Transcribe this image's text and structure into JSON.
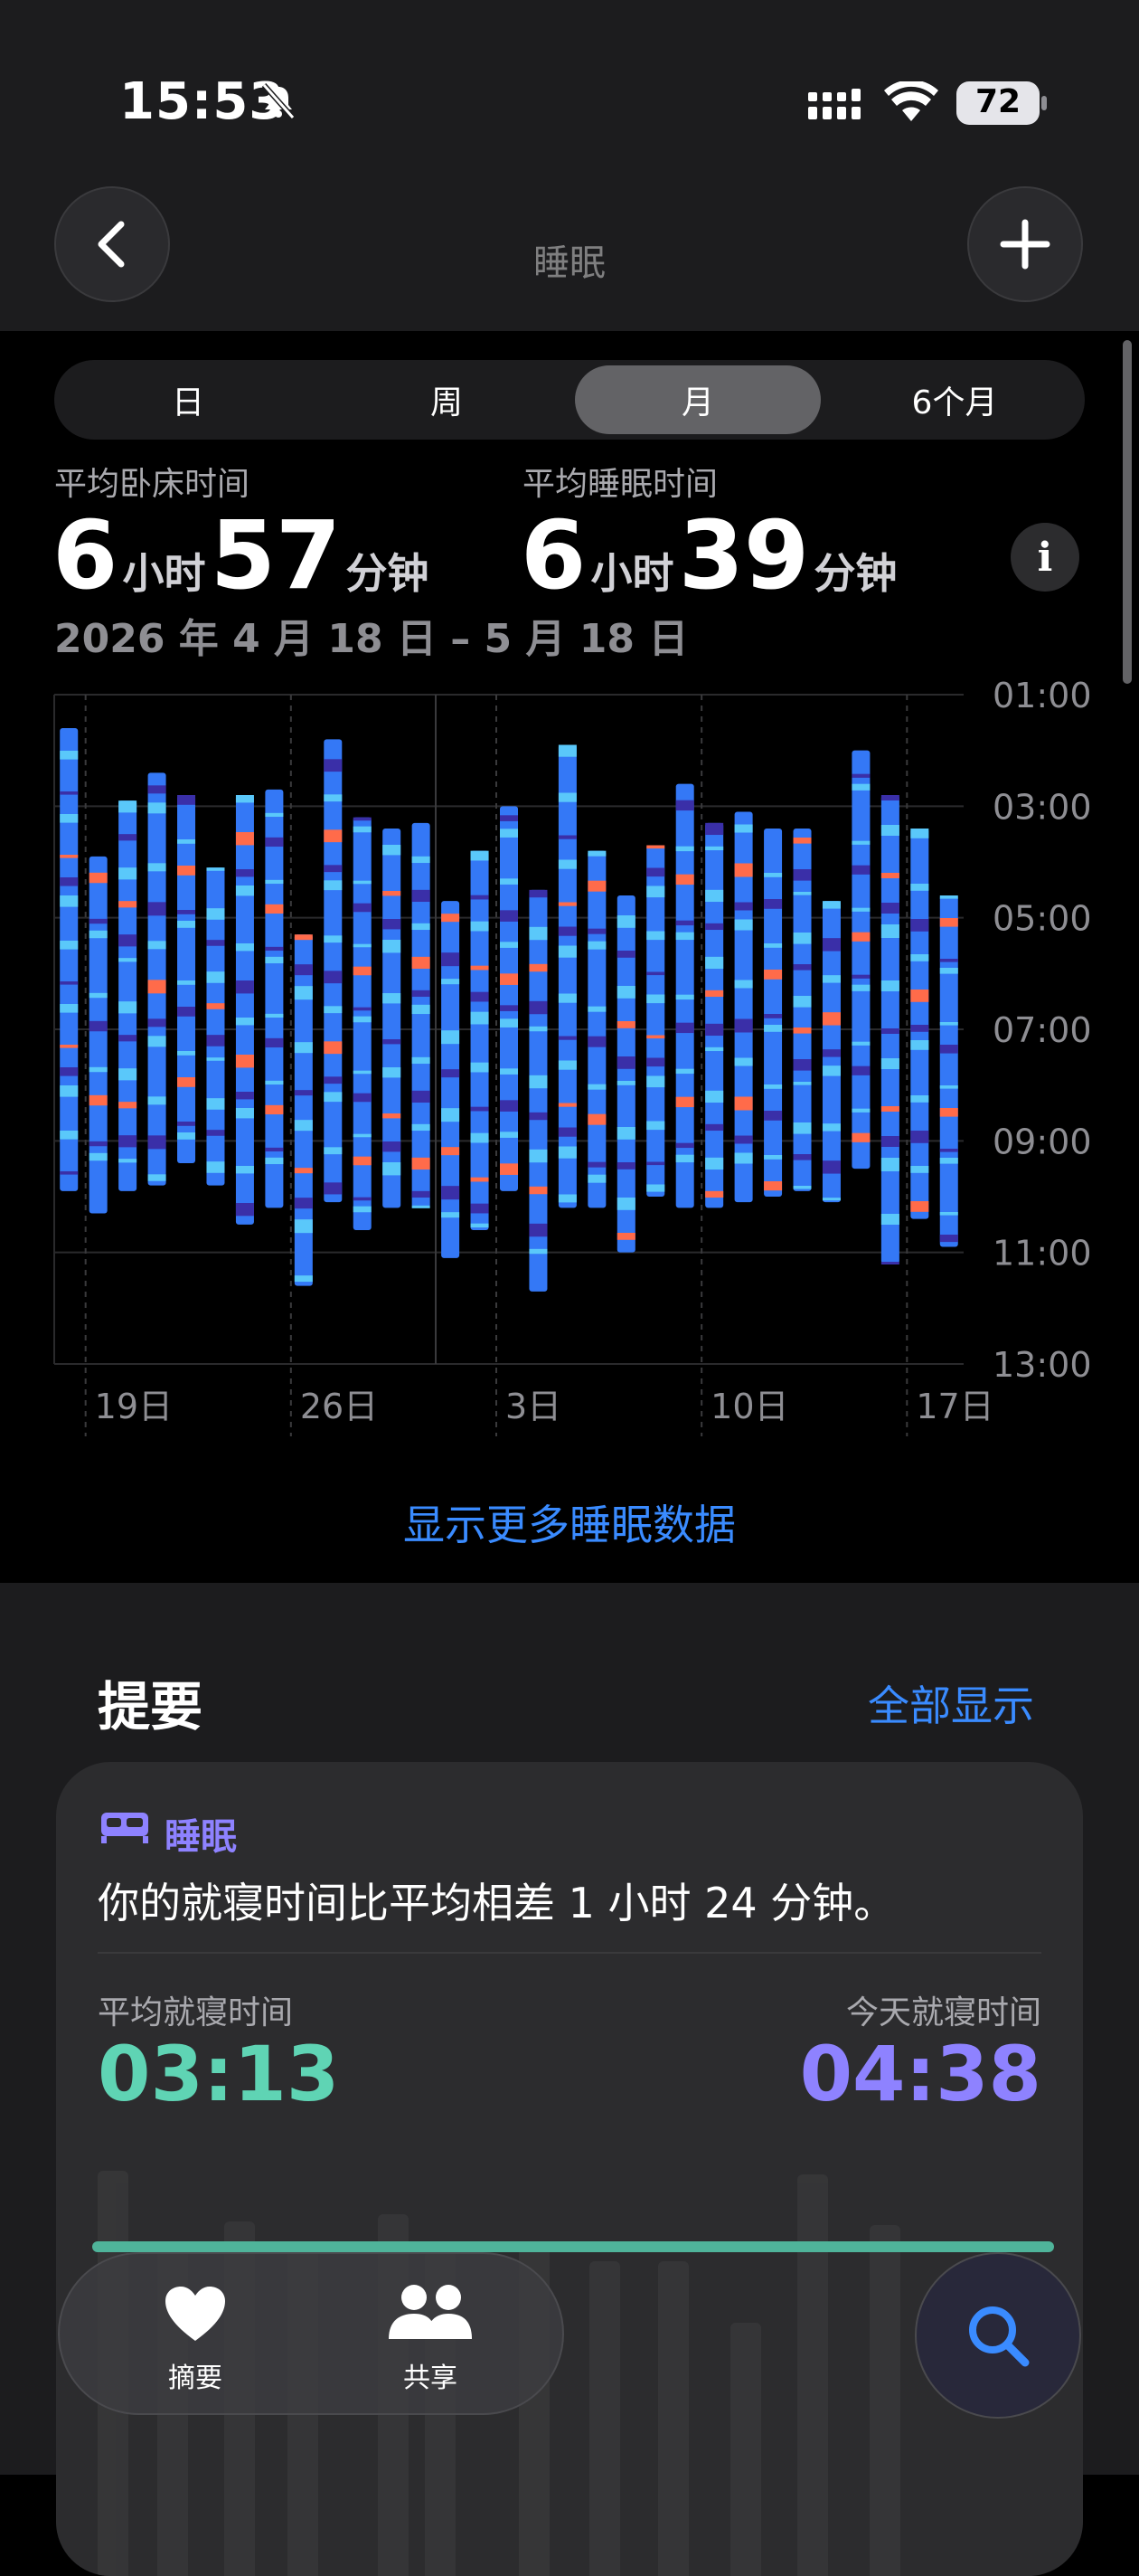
{
  "status_bar": {
    "time": "15:53",
    "battery": "72"
  },
  "nav": {
    "title": "睡眠"
  },
  "segments": [
    {
      "label": "日",
      "active": false
    },
    {
      "label": "周",
      "active": false
    },
    {
      "label": "月",
      "active": true
    },
    {
      "label": "6个月",
      "active": false
    }
  ],
  "stats": {
    "in_bed": {
      "label": "平均卧床时间",
      "hours": "6",
      "hours_unit": "小时",
      "minutes": "57",
      "minutes_unit": "分钟"
    },
    "asleep": {
      "label": "平均睡眠时间",
      "hours": "6",
      "hours_unit": "小时",
      "minutes": "39",
      "minutes_unit": "分钟"
    },
    "date_range": "2026 年 4 月 18 日 – 5 月 18 日"
  },
  "chart_data": {
    "type": "bar",
    "y_ticks": [
      "01:00",
      "03:00",
      "05:00",
      "07:00",
      "09:00",
      "11:00",
      "13:00"
    ],
    "x_ticks": [
      "19日",
      "26日",
      "3日",
      "10日",
      "17日"
    ],
    "ylim": [
      1,
      13
    ],
    "grid": true,
    "nights": [
      {
        "day": "4/18",
        "start": 1.6,
        "end": 9.9
      },
      {
        "day": "4/19",
        "start": 3.9,
        "end": 10.3
      },
      {
        "day": "4/20",
        "start": 2.9,
        "end": 9.9
      },
      {
        "day": "4/21",
        "start": 2.4,
        "end": 9.8
      },
      {
        "day": "4/22",
        "start": 2.8,
        "end": 9.4
      },
      {
        "day": "4/23",
        "start": 4.1,
        "end": 9.8
      },
      {
        "day": "4/24",
        "start": 2.8,
        "end": 10.5
      },
      {
        "day": "4/25",
        "start": 2.7,
        "end": 10.2
      },
      {
        "day": "4/26",
        "start": 5.3,
        "end": 11.6
      },
      {
        "day": "4/27",
        "start": 1.8,
        "end": 10.1
      },
      {
        "day": "4/28",
        "start": 3.2,
        "end": 10.6
      },
      {
        "day": "4/29",
        "start": 3.4,
        "end": 10.2
      },
      {
        "day": "4/30",
        "start": 3.3,
        "end": 10.2
      },
      {
        "day": "5/1",
        "start": 4.7,
        "end": 11.1
      },
      {
        "day": "5/2",
        "start": 3.8,
        "end": 10.6
      },
      {
        "day": "5/3",
        "start": 3.0,
        "end": 9.9
      },
      {
        "day": "5/4",
        "start": 4.5,
        "end": 11.7
      },
      {
        "day": "5/5",
        "start": 1.9,
        "end": 10.2
      },
      {
        "day": "5/6",
        "start": 3.8,
        "end": 10.2
      },
      {
        "day": "5/7",
        "start": 4.6,
        "end": 11.0
      },
      {
        "day": "5/8",
        "start": 3.7,
        "end": 10.0
      },
      {
        "day": "5/9",
        "start": 2.6,
        "end": 10.2
      },
      {
        "day": "5/10",
        "start": 3.3,
        "end": 10.2
      },
      {
        "day": "5/11",
        "start": 3.1,
        "end": 10.1
      },
      {
        "day": "5/12",
        "start": 3.4,
        "end": 10.0
      },
      {
        "day": "5/13",
        "start": 3.4,
        "end": 9.9
      },
      {
        "day": "5/14",
        "start": 4.7,
        "end": 10.1
      },
      {
        "day": "5/15",
        "start": 2.0,
        "end": 9.5
      },
      {
        "day": "5/16",
        "start": 2.8,
        "end": 11.2
      },
      {
        "day": "5/17",
        "start": 3.4,
        "end": 10.4
      },
      {
        "day": "5/18",
        "start": 4.6,
        "end": 10.9
      }
    ],
    "stage_colors": {
      "core": "#3478f6",
      "rem": "#5ac8fa",
      "deep": "#3a2fa8",
      "awake": "#ff6b4a"
    }
  },
  "show_more": "显示更多睡眠数据",
  "summary": {
    "title": "提要",
    "show_all": "全部显示",
    "card": {
      "tag": "睡眠",
      "text": "你的就寝时间比平均相差 1 小时 24 分钟。",
      "avg_label": "平均就寝时间",
      "avg_value": "03:13",
      "today_label": "今天就寝时间",
      "today_value": "04:38"
    }
  },
  "tabbar": {
    "items": [
      {
        "label": "摘要"
      },
      {
        "label": "共享"
      }
    ]
  },
  "colors": {
    "accent": "#3a8bff",
    "avg": "#5fd4b4",
    "today": "#8e82ff"
  }
}
